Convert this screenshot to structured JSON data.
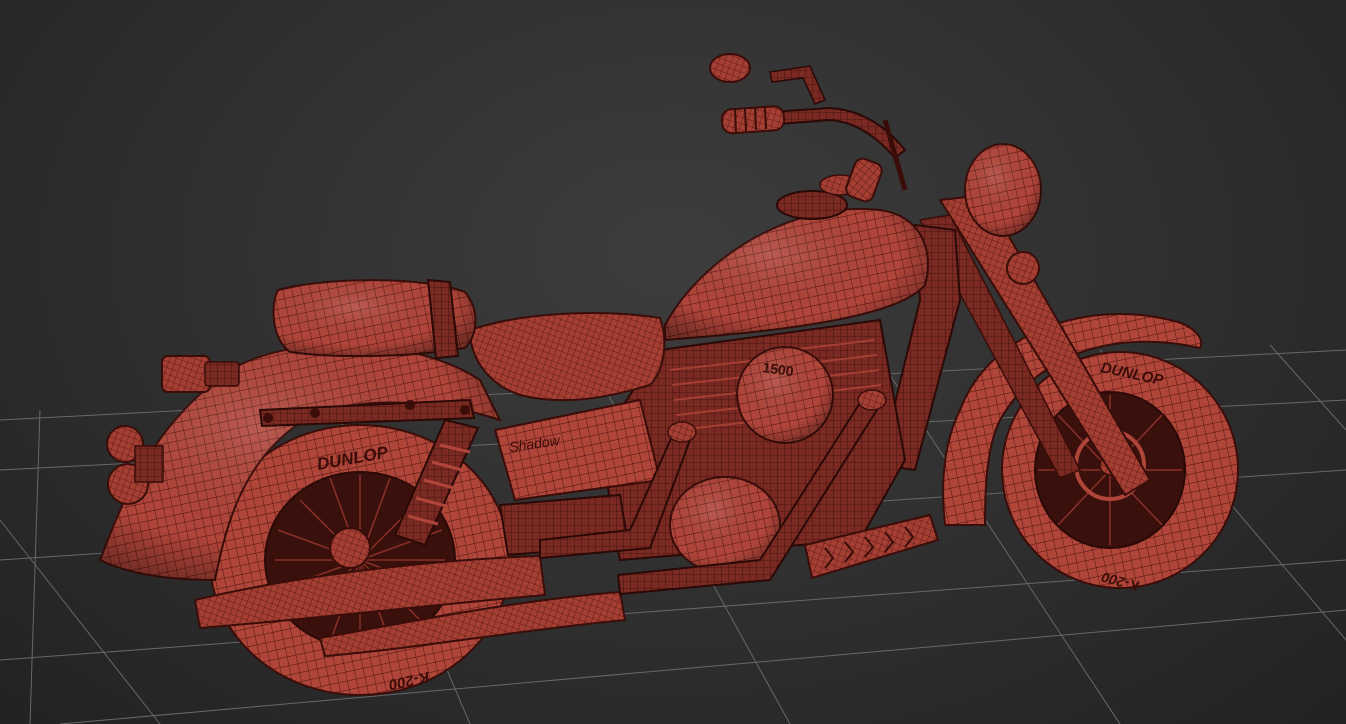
{
  "scene": {
    "background_color": "#2e2e2e",
    "grid_color": "#6a6a6a",
    "mesh_color": "#b5493b",
    "wire_color": "#4a120d"
  },
  "tire_labels": {
    "rear_brand": "DUNLOP",
    "rear_model": "K-200",
    "front_brand": "DUNLOP",
    "front_model": "K-200"
  },
  "engine_label": "1500",
  "side_cover_label": "Shadow"
}
